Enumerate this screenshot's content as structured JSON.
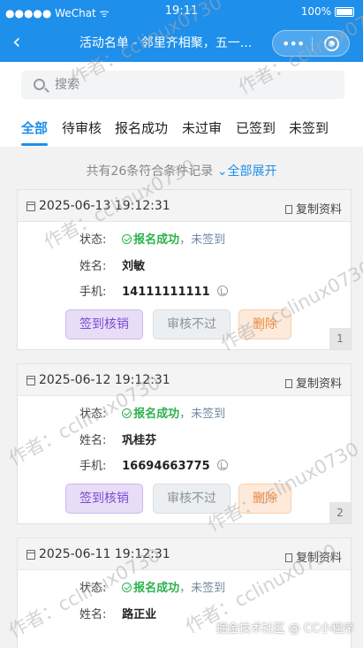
{
  "status_bar": {
    "carrier": "●●●●● WeChat",
    "wifi": "ᯤ",
    "time": "19:11",
    "battery": "100%"
  },
  "nav": {
    "back": "‹",
    "title": "活动名单 - 邻里齐相聚，五一...",
    "more": "•••"
  },
  "search": {
    "placeholder": "搜索"
  },
  "tabs": [
    "全部",
    "待审核",
    "报名成功",
    "未过审",
    "已签到",
    "未签到"
  ],
  "active_tab": "全部",
  "summary": {
    "text": "共有26条符合条件记录",
    "expand": "⌄全部展开"
  },
  "labels": {
    "status": "状态:",
    "name": "姓名:",
    "phone": "手机:",
    "copy": "复制资料",
    "sign_in": "签到核销",
    "reject": "审核不过",
    "delete": "删除"
  },
  "records": [
    {
      "date": "2025-06-13 19:12:31",
      "status": "报名成功",
      "sign_status": "，未签到",
      "name": "刘敏",
      "phone": "14111111111",
      "index": "1"
    },
    {
      "date": "2025-06-12 19:12:31",
      "status": "报名成功",
      "sign_status": "，未签到",
      "name": "巩桂芬",
      "phone": "16694663775",
      "index": "2"
    },
    {
      "date": "2025-06-11 19:12:31",
      "status": "报名成功",
      "sign_status": "，未签到",
      "name": "路正业",
      "phone": "",
      "index": ""
    }
  ],
  "watermark": "作者：cclinux0730",
  "credit": "掘金技术社区 @ CC小程序"
}
